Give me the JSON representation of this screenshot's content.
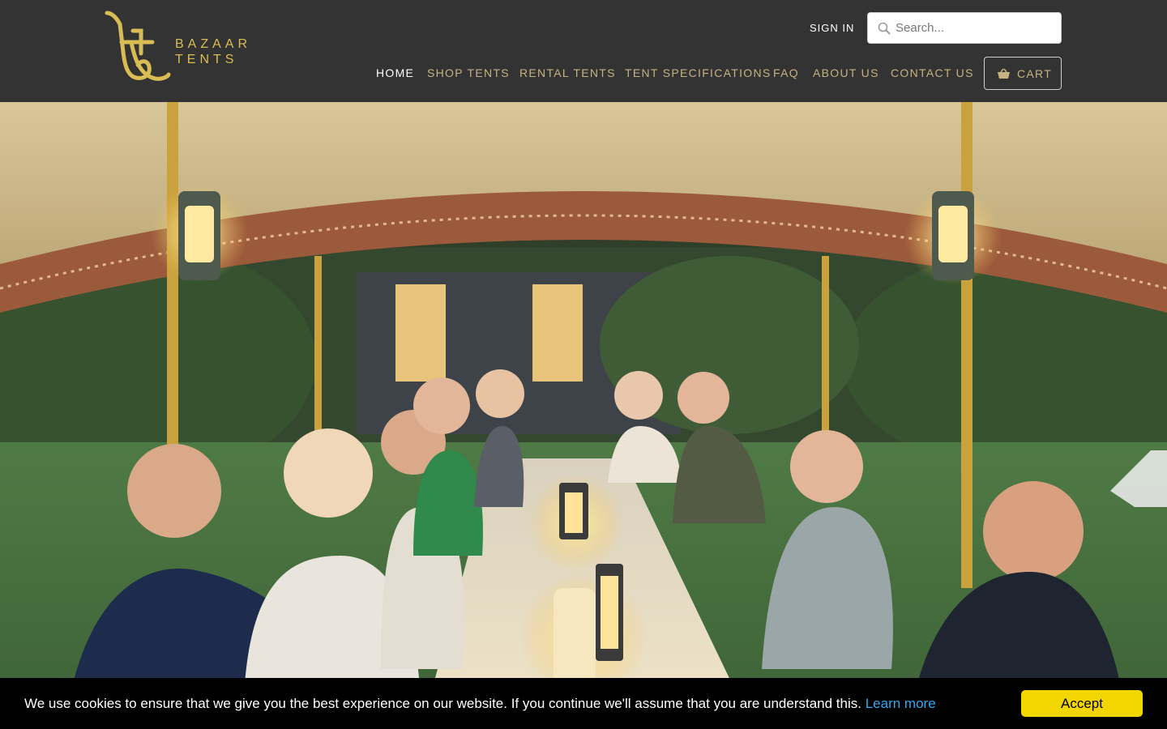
{
  "brand": {
    "name_line1": "BAZAAR",
    "name_line2": "TENTS",
    "color": "#d9bd54"
  },
  "header": {
    "sign_in": "SIGN IN",
    "search": {
      "placeholder": "Search...",
      "value": ""
    },
    "nav": [
      {
        "label": "HOME",
        "active": true
      },
      {
        "label": "SHOP TENTS",
        "active": false
      },
      {
        "label": "RENTAL TENTS",
        "active": false
      },
      {
        "label": "TENT SPECIFICATIONS",
        "active": false
      },
      {
        "label": "FAQ",
        "active": false
      },
      {
        "label": "ABOUT US",
        "active": false
      },
      {
        "label": "CONTACT US",
        "active": false
      }
    ],
    "cart_label": "CART",
    "nav_color": "#c7b382",
    "background": "#333333"
  },
  "hero": {
    "image_icon": "photo-icon"
  },
  "cookie_banner": {
    "message": "We use cookies to ensure that we give you the best experience on our website. If you continue we'll assume that you are understand this.",
    "learn_more": "Learn more",
    "accept": "Accept",
    "accept_color": "#f1d600",
    "link_color": "#31a8f0"
  }
}
